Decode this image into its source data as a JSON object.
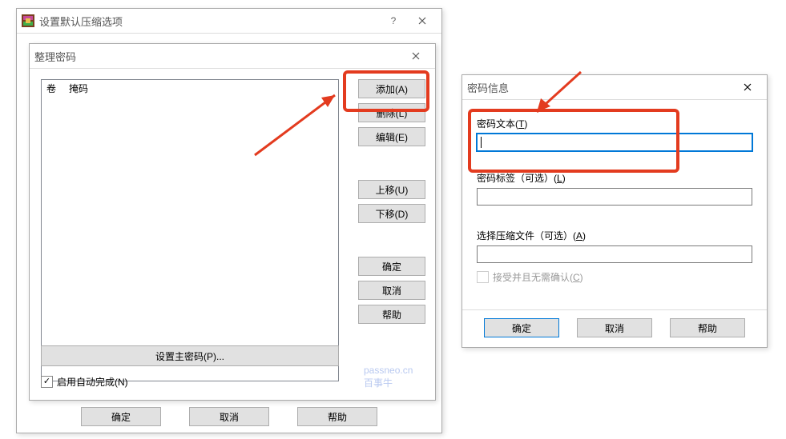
{
  "parentDialog": {
    "title": "设置默认压缩选项",
    "buttons": {
      "ok": "确定",
      "cancel": "取消",
      "help": "帮助"
    }
  },
  "organizeDialog": {
    "title": "整理密码",
    "columns": {
      "vol": "卷",
      "mask": "掩码"
    },
    "sideButtons": {
      "add": "添加(A)",
      "del": "删除(L)",
      "edit": "编辑(E)",
      "up": "上移(U)",
      "down": "下移(D)",
      "ok": "确定",
      "cancel": "取消",
      "help": "帮助"
    },
    "setMaster": "设置主密码(P)...",
    "autoComplete": "启用自动完成(N)"
  },
  "infoDialog": {
    "title": "密码信息",
    "labels": {
      "pwdText_pre": "密码文本(",
      "pwdText_u": "T",
      "pwdText_post": ")",
      "pwdLabel_pre": "密码标签（可选）(",
      "pwdLabel_u": "L",
      "pwdLabel_post": ")",
      "archive_pre": "选择压缩文件（可选）(",
      "archive_u": "A",
      "archive_post": ")",
      "accept_pre": "接受并且无需确认(",
      "accept_u": "C",
      "accept_post": ")"
    },
    "buttons": {
      "ok": "确定",
      "cancel": "取消",
      "help": "帮助"
    }
  },
  "watermark": {
    "line1": "passneo.cn",
    "line2": "百事牛"
  }
}
